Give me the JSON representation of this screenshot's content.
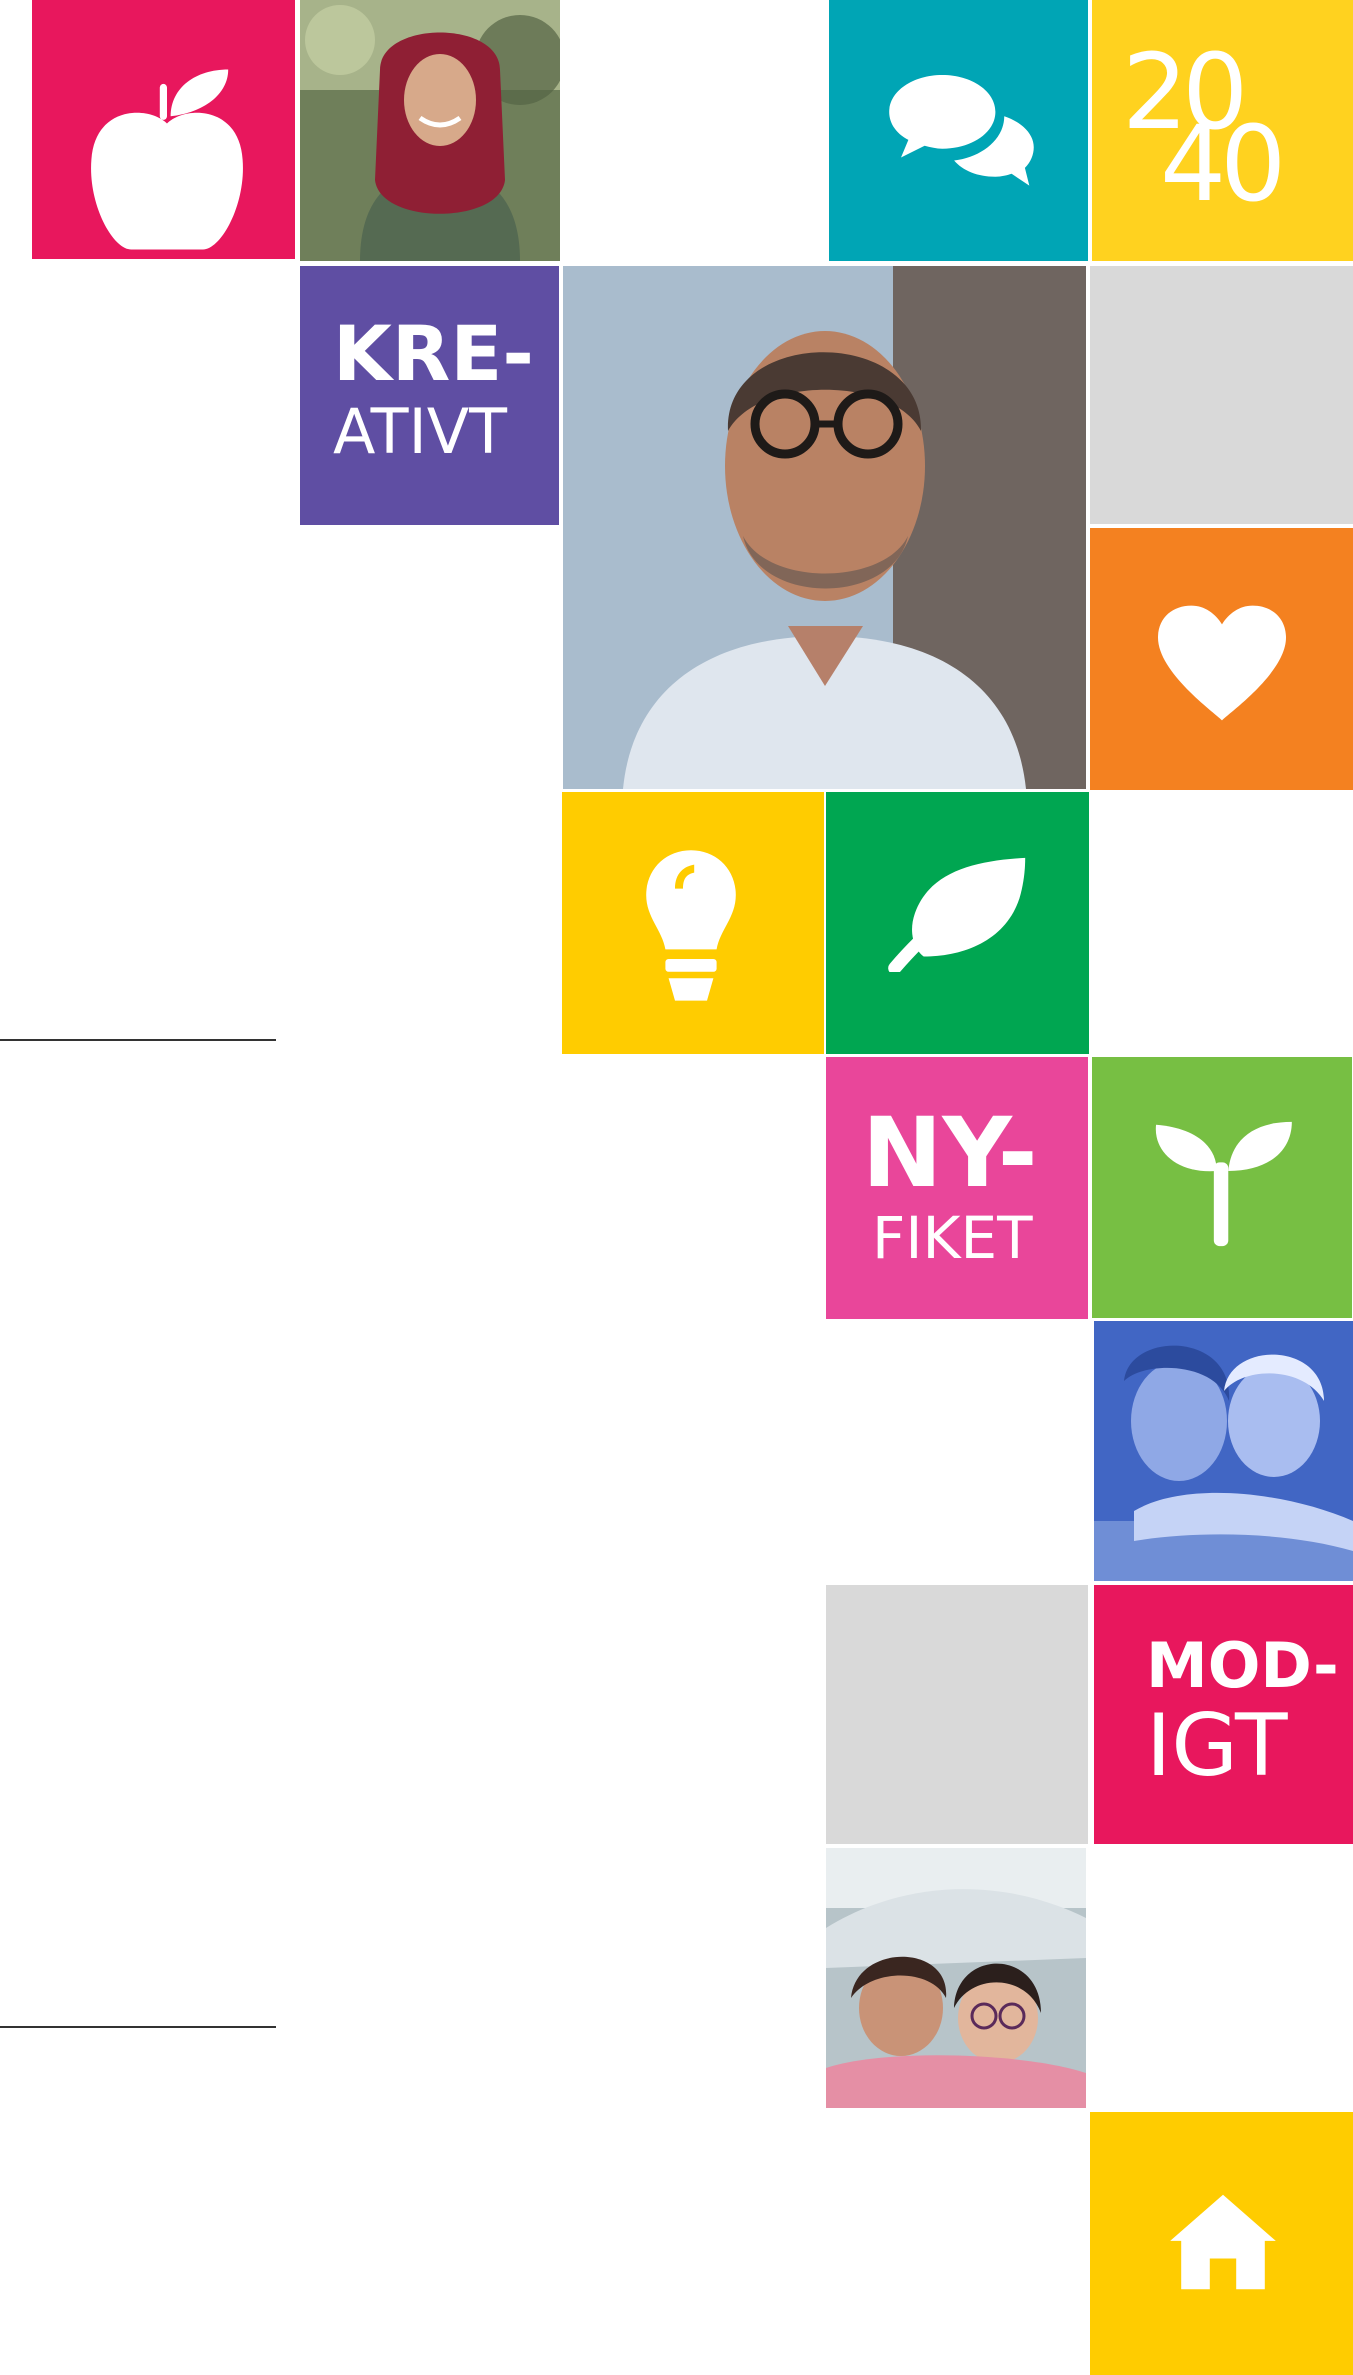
{
  "tiles": {
    "kreativt": {
      "line1": "KRE-",
      "line2": "ATIVT",
      "color": "#5f4ea3"
    },
    "nyfiket": {
      "line1": "NY-",
      "line2": "FIKET",
      "color": "#e9469a"
    },
    "modigt": {
      "line1": "MOD-",
      "line2": "IGT",
      "color": "#e8175d"
    },
    "year": {
      "top": "20",
      "bottom": "40",
      "color": "#ffd21f"
    }
  },
  "icons": {
    "apple": "apple-icon",
    "chat": "speech-bubbles-icon",
    "heart": "heart-icon",
    "bulb": "lightbulb-icon",
    "leaf": "leaf-icon",
    "sprout": "sprout-icon",
    "home": "house-icon"
  },
  "colors": {
    "magenta": "#e8175d",
    "teal": "#00a5b5",
    "yellow": "#ffd21f",
    "purple": "#5f4ea3",
    "grey": "#d9d9d9",
    "orange": "#f48120",
    "green": "#00a651",
    "pink": "#e9469a",
    "lime": "#77bf43"
  }
}
